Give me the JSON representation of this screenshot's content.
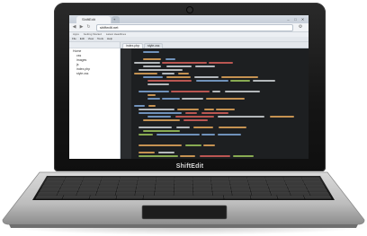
{
  "browser": {
    "tab_title": "ShiftEdit",
    "url": "shiftedit.net",
    "bookmarks": [
      "Apps",
      "Getting Started",
      "Latest Headlines"
    ],
    "window_buttons": [
      "–",
      "□",
      "✕"
    ]
  },
  "app": {
    "menus": [
      "File",
      "Edit",
      "View",
      "Tools",
      "Help"
    ],
    "tree_items": [
      "Home",
      "css",
      "images",
      "js",
      "index.php",
      "style.css"
    ],
    "editor_tabs": [
      "index.php",
      "style.css"
    ]
  },
  "laptop": {
    "brand": "ShiftEdit"
  },
  "colors": {
    "editor_bg": "#1d1f21",
    "code_orange": "#e3a75a",
    "code_green": "#9bc45a",
    "code_white": "#cfd3d6",
    "code_blue": "#7fa7d6",
    "code_red": "#d6605a"
  }
}
